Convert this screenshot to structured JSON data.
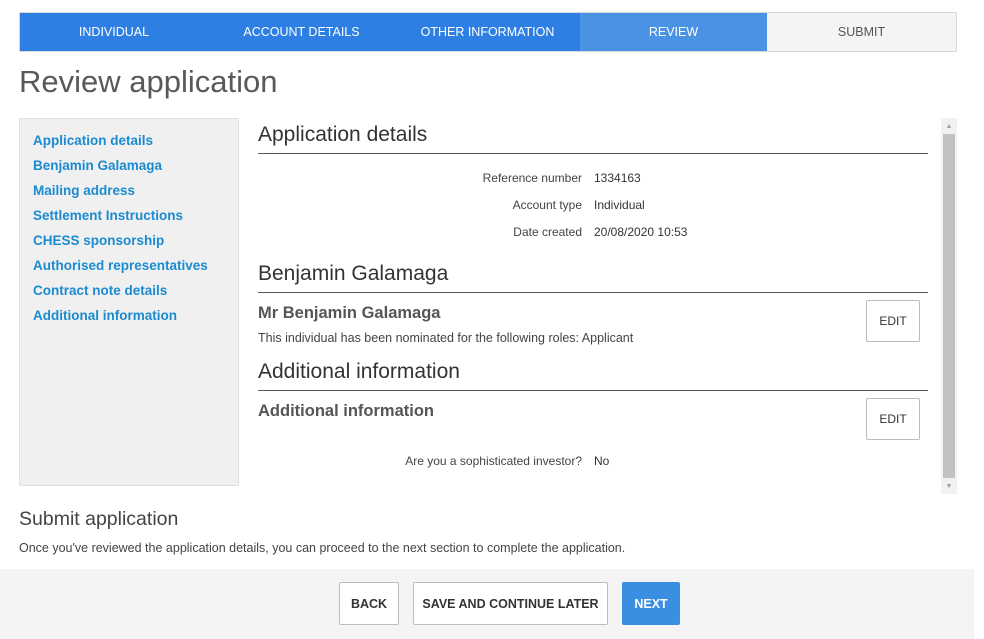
{
  "stepper": {
    "steps": [
      {
        "label": "INDIVIDUAL",
        "state": "done"
      },
      {
        "label": "ACCOUNT DETAILS",
        "state": "done"
      },
      {
        "label": "OTHER INFORMATION",
        "state": "done"
      },
      {
        "label": "REVIEW",
        "state": "current"
      },
      {
        "label": "SUBMIT",
        "state": "todo"
      }
    ]
  },
  "page": {
    "title": "Review application"
  },
  "sidebar": {
    "items": [
      {
        "label": "Application details"
      },
      {
        "label": "Benjamin Galamaga"
      },
      {
        "label": "Mailing address"
      },
      {
        "label": "Settlement Instructions"
      },
      {
        "label": "CHESS sponsorship"
      },
      {
        "label": "Authorised representatives"
      },
      {
        "label": "Contract note details"
      },
      {
        "label": "Additional information"
      }
    ]
  },
  "review": {
    "application": {
      "title": "Application details",
      "fields": [
        {
          "label": "Reference number",
          "value": "1334163"
        },
        {
          "label": "Account type",
          "value": "Individual"
        },
        {
          "label": "Date created",
          "value": "20/08/2020 10:53"
        }
      ]
    },
    "person": {
      "title": "Benjamin Galamaga",
      "name": "Mr Benjamin Galamaga",
      "note": "This individual has been nominated for the following roles: Applicant",
      "edit_label": "EDIT"
    },
    "additional": {
      "title": "Additional information",
      "subtitle": "Additional information",
      "edit_label": "EDIT",
      "question": "Are you a sophisticated investor?",
      "answer": "No"
    }
  },
  "submit": {
    "heading": "Submit application",
    "text": "Once you've reviewed the application details, you can proceed to the next section to complete the application."
  },
  "footer": {
    "back_label": "BACK",
    "save_label": "SAVE AND CONTINUE LATER",
    "next_label": "NEXT"
  },
  "colors": {
    "accent": "#2d7fe4",
    "current_step": "#4a92e3",
    "link": "#1a8bd1",
    "primary_button": "#3b8fe3"
  }
}
